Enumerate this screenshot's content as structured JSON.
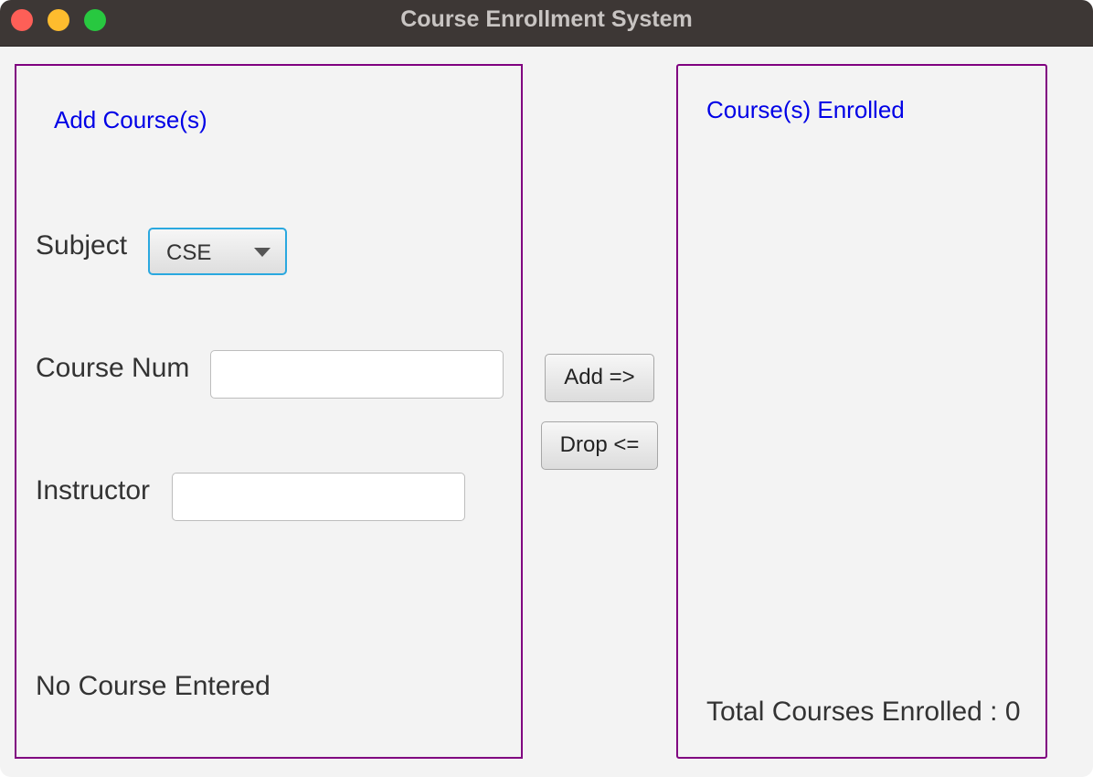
{
  "window": {
    "title": "Course Enrollment System"
  },
  "left_panel": {
    "heading": "Add Course(s)",
    "subject_label": "Subject",
    "subject_selected": "CSE",
    "course_num_label": "Course Num",
    "course_num_value": "",
    "instructor_label": "Instructor",
    "instructor_value": "",
    "status": "No Course Entered"
  },
  "buttons": {
    "add": "Add =>",
    "drop": "Drop <="
  },
  "right_panel": {
    "heading": "Course(s) Enrolled",
    "total": "Total Courses Enrolled : 0"
  },
  "colors": {
    "accent_border": "#800080",
    "heading_text": "#0000e6",
    "focus_ring": "#2aa8df"
  }
}
